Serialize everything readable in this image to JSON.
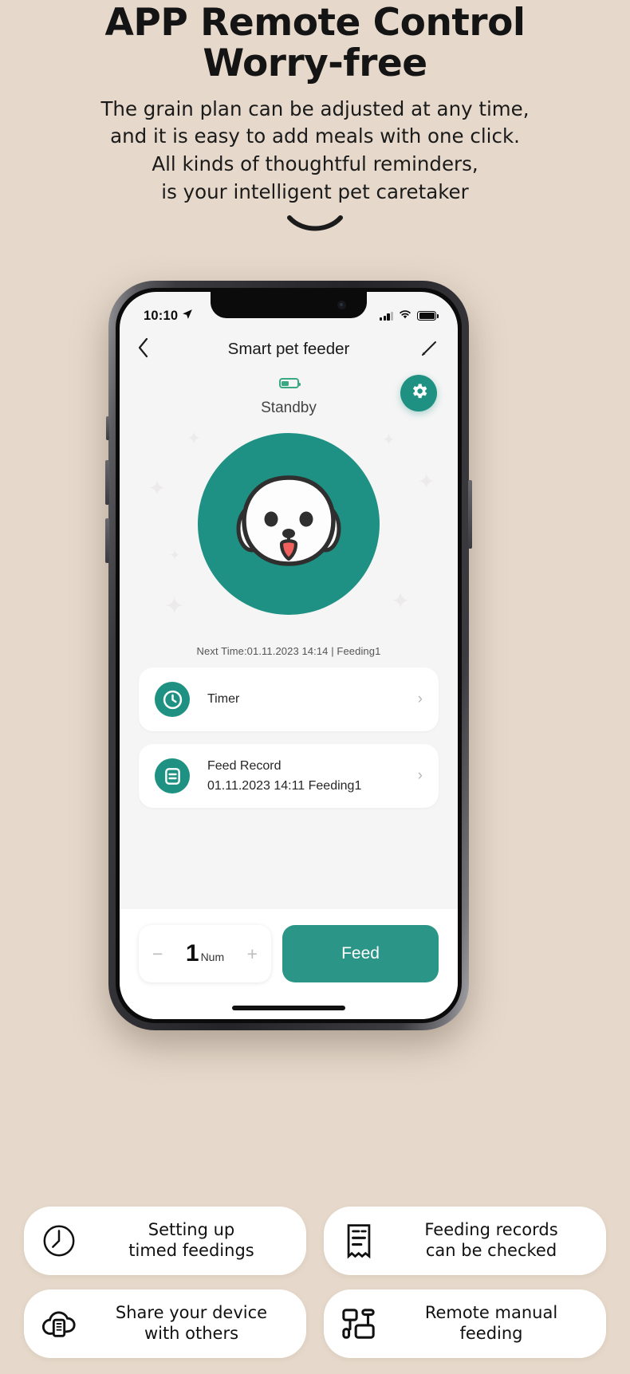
{
  "hero": {
    "title_line1": "APP Remote Control",
    "title_line2": "Worry-free",
    "sub_line1": "The grain plan can be adjusted at any time,",
    "sub_line2": "and it is easy to add meals with one click.",
    "sub_line3": "All kinds of thoughtful reminders,",
    "sub_line4": "is your intelligent pet caretaker"
  },
  "phone": {
    "statusbar": {
      "time": "10:10",
      "location_icon": "location-arrow-icon",
      "signal_icon": "cellular-signal-icon",
      "wifi_icon": "wifi-icon",
      "battery_icon": "battery-icon"
    },
    "navbar": {
      "back_icon": "chevron-left-icon",
      "title": "Smart pet feeder",
      "edit_icon": "pencil-edit-icon"
    },
    "device": {
      "battery_icon": "device-battery-icon",
      "battery_level_percent": 48,
      "state": "Standby",
      "settings_icon": "gear-icon",
      "pet_avatar_icon": "dog-face-icon",
      "next_time": "Next Time:01.11.2023 14:14 | Feeding1",
      "accent_color": "#1f9182",
      "circle_color": "#1e9184"
    },
    "cards": [
      {
        "icon": "clock-icon",
        "title": "Timer",
        "subtitle": "",
        "arrow": "›"
      },
      {
        "icon": "document-list-icon",
        "title": "Feed Record",
        "subtitle": "01.11.2023 14:11 Feeding1",
        "arrow": "›"
      }
    ],
    "bottom": {
      "minus_label": "−",
      "quantity": "1",
      "unit": "Num",
      "plus_label": "+",
      "feed_label": "Feed",
      "feed_color": "#2b9688"
    }
  },
  "features": [
    {
      "icon": "clock-outline-icon",
      "line1": "Setting up",
      "line2": "timed feedings"
    },
    {
      "icon": "receipt-icon",
      "line1": "Feeding records",
      "line2": "can be checked"
    },
    {
      "icon": "cloud-phone-icon",
      "line1": "Share your device",
      "line2": "with others"
    },
    {
      "icon": "remote-devices-icon",
      "line1": "Remote manual",
      "line2": "feeding"
    }
  ],
  "theme": {
    "background": "#e6d9cb",
    "accent": "#1f9182",
    "text": "#111111"
  }
}
